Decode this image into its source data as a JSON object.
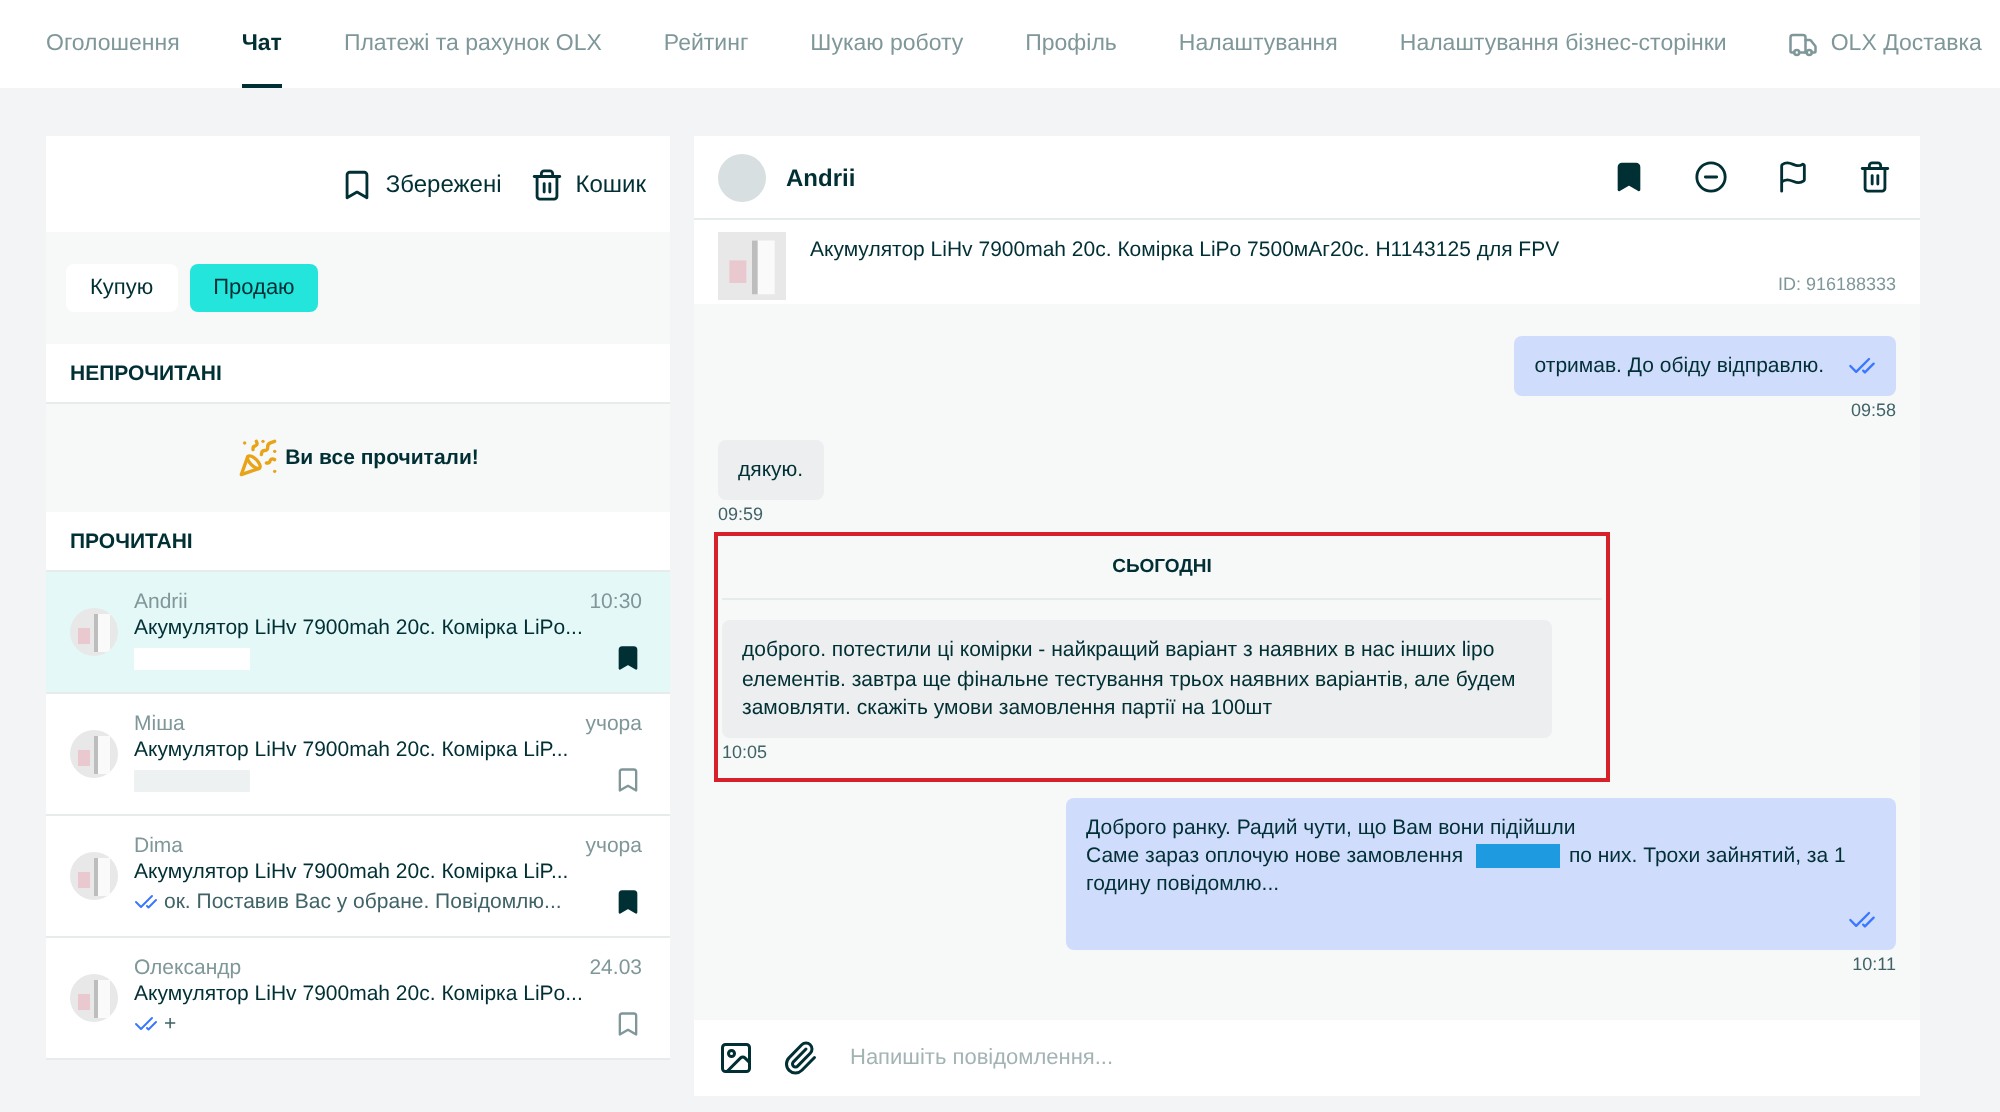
{
  "nav": {
    "tabs": [
      {
        "label": "Оголошення",
        "selected": false,
        "kind": "text"
      },
      {
        "label": "Чат",
        "selected": true,
        "kind": "text"
      },
      {
        "label": "Платежі та рахунок OLX",
        "selected": false,
        "kind": "text"
      },
      {
        "label": "Рейтинг",
        "selected": false,
        "kind": "text"
      },
      {
        "label": "Шукаю роботу",
        "selected": false,
        "kind": "text"
      },
      {
        "label": "Профіль",
        "selected": false,
        "kind": "text"
      },
      {
        "label": "Налаштування",
        "selected": false,
        "kind": "text"
      },
      {
        "label": "Налаштування бізнес-сторінки",
        "selected": false,
        "kind": "text"
      },
      {
        "label": "OLX Доставка",
        "selected": false,
        "kind": "delivery"
      }
    ]
  },
  "sidebar": {
    "actions": [
      {
        "label": "Збережені",
        "kind": "saved"
      },
      {
        "label": "Кошик",
        "kind": "trash"
      }
    ],
    "toggle": [
      {
        "label": "Купую",
        "selected": false
      },
      {
        "label": "Продаю",
        "selected": true
      }
    ],
    "unread_heading": "НЕПРОЧИТАНІ",
    "empty_note": "Ви все прочитали!",
    "read_heading": "ПРОЧИТАНІ",
    "conversations": [
      {
        "name": "Andrii",
        "time": "10:30",
        "title": "Акумулятор LiHv 7900mah 20c. Комірка LiPo...",
        "selected": true,
        "saved": true,
        "kind": "redacted"
      },
      {
        "name": "Міша",
        "time": "учора",
        "title": "Акумулятор LiHv 7900mah 20c. Комірка LiP...",
        "selected": false,
        "saved": false,
        "kind": "redacted"
      },
      {
        "name": "Dima",
        "time": "учора",
        "title": "Акумулятор LiHv 7900mah 20c. Комірка LiP...",
        "selected": false,
        "saved": true,
        "kind": "read",
        "preview": "ок. Поставив Вас у обране. Повідомлю..."
      },
      {
        "name": "Олександр",
        "time": "24.03",
        "title": "Акумулятор LiHv 7900mah 20c. Комірка LiPo...",
        "selected": false,
        "saved": false,
        "kind": "read",
        "preview": "+"
      }
    ]
  },
  "chat": {
    "contact": "Andrii",
    "saved": true,
    "header_actions": [
      {
        "kind": "bookmark"
      },
      {
        "kind": "block"
      },
      {
        "kind": "report"
      },
      {
        "kind": "delete"
      }
    ],
    "listing": {
      "title": "Акумулятор LiHv 7900mah 20c. Комірка LiPo 7500мАг20с. H1143125 для FPV",
      "id": "ID: 916188333"
    },
    "messages": [
      {
        "kind": "outgoing",
        "parts": [
          {
            "kind": "text",
            "text": "отримав. До обіду відправлю."
          }
        ],
        "time": "09:58",
        "read": true,
        "highlighted": false
      },
      {
        "kind": "incoming",
        "parts": [
          {
            "kind": "text",
            "text": "дякую."
          }
        ],
        "time": "09:59",
        "highlighted": false
      },
      {
        "kind": "divider",
        "label": "СЬОГОДНІ",
        "highlighted": true
      },
      {
        "kind": "incoming",
        "parts": [
          {
            "kind": "text",
            "text": "доброго. потестили ці комірки - найкращий варіант з наявних в нас інших lipo елементів. завтра ще фінальне тестування трьох наявних варіантів, але будем замовляти. скажіть умови замовлення партії на 100шт"
          }
        ],
        "time": "10:05",
        "highlighted": true
      },
      {
        "kind": "outgoing",
        "parts": [
          {
            "kind": "text",
            "text": "Доброго ранку. Радий чути, що Вам вони підійшли"
          },
          {
            "kind": "break"
          },
          {
            "kind": "text",
            "text": "Саме зараз оплочую нове замовлення"
          },
          {
            "kind": "redacted"
          },
          {
            "kind": "text",
            "text": "по них. Трохи зайнятий, за 1 годину повідомлю..."
          }
        ],
        "time": "10:11",
        "read": true,
        "highlighted": false
      }
    ],
    "composer": {
      "placeholder": "Напишіть повідомлення..."
    }
  }
}
